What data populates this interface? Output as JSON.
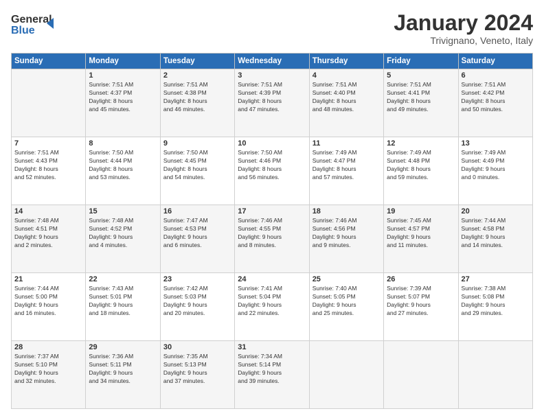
{
  "header": {
    "logo_line1": "General",
    "logo_line2": "Blue",
    "month_title": "January 2024",
    "location": "Trivignano, Veneto, Italy"
  },
  "weekdays": [
    "Sunday",
    "Monday",
    "Tuesday",
    "Wednesday",
    "Thursday",
    "Friday",
    "Saturday"
  ],
  "weeks": [
    [
      {
        "day": "",
        "content": ""
      },
      {
        "day": "1",
        "content": "Sunrise: 7:51 AM\nSunset: 4:37 PM\nDaylight: 8 hours\nand 45 minutes."
      },
      {
        "day": "2",
        "content": "Sunrise: 7:51 AM\nSunset: 4:38 PM\nDaylight: 8 hours\nand 46 minutes."
      },
      {
        "day": "3",
        "content": "Sunrise: 7:51 AM\nSunset: 4:39 PM\nDaylight: 8 hours\nand 47 minutes."
      },
      {
        "day": "4",
        "content": "Sunrise: 7:51 AM\nSunset: 4:40 PM\nDaylight: 8 hours\nand 48 minutes."
      },
      {
        "day": "5",
        "content": "Sunrise: 7:51 AM\nSunset: 4:41 PM\nDaylight: 8 hours\nand 49 minutes."
      },
      {
        "day": "6",
        "content": "Sunrise: 7:51 AM\nSunset: 4:42 PM\nDaylight: 8 hours\nand 50 minutes."
      }
    ],
    [
      {
        "day": "7",
        "content": "Sunrise: 7:51 AM\nSunset: 4:43 PM\nDaylight: 8 hours\nand 52 minutes."
      },
      {
        "day": "8",
        "content": "Sunrise: 7:50 AM\nSunset: 4:44 PM\nDaylight: 8 hours\nand 53 minutes."
      },
      {
        "day": "9",
        "content": "Sunrise: 7:50 AM\nSunset: 4:45 PM\nDaylight: 8 hours\nand 54 minutes."
      },
      {
        "day": "10",
        "content": "Sunrise: 7:50 AM\nSunset: 4:46 PM\nDaylight: 8 hours\nand 56 minutes."
      },
      {
        "day": "11",
        "content": "Sunrise: 7:49 AM\nSunset: 4:47 PM\nDaylight: 8 hours\nand 57 minutes."
      },
      {
        "day": "12",
        "content": "Sunrise: 7:49 AM\nSunset: 4:48 PM\nDaylight: 8 hours\nand 59 minutes."
      },
      {
        "day": "13",
        "content": "Sunrise: 7:49 AM\nSunset: 4:49 PM\nDaylight: 9 hours\nand 0 minutes."
      }
    ],
    [
      {
        "day": "14",
        "content": "Sunrise: 7:48 AM\nSunset: 4:51 PM\nDaylight: 9 hours\nand 2 minutes."
      },
      {
        "day": "15",
        "content": "Sunrise: 7:48 AM\nSunset: 4:52 PM\nDaylight: 9 hours\nand 4 minutes."
      },
      {
        "day": "16",
        "content": "Sunrise: 7:47 AM\nSunset: 4:53 PM\nDaylight: 9 hours\nand 6 minutes."
      },
      {
        "day": "17",
        "content": "Sunrise: 7:46 AM\nSunset: 4:55 PM\nDaylight: 9 hours\nand 8 minutes."
      },
      {
        "day": "18",
        "content": "Sunrise: 7:46 AM\nSunset: 4:56 PM\nDaylight: 9 hours\nand 9 minutes."
      },
      {
        "day": "19",
        "content": "Sunrise: 7:45 AM\nSunset: 4:57 PM\nDaylight: 9 hours\nand 11 minutes."
      },
      {
        "day": "20",
        "content": "Sunrise: 7:44 AM\nSunset: 4:58 PM\nDaylight: 9 hours\nand 14 minutes."
      }
    ],
    [
      {
        "day": "21",
        "content": "Sunrise: 7:44 AM\nSunset: 5:00 PM\nDaylight: 9 hours\nand 16 minutes."
      },
      {
        "day": "22",
        "content": "Sunrise: 7:43 AM\nSunset: 5:01 PM\nDaylight: 9 hours\nand 18 minutes."
      },
      {
        "day": "23",
        "content": "Sunrise: 7:42 AM\nSunset: 5:03 PM\nDaylight: 9 hours\nand 20 minutes."
      },
      {
        "day": "24",
        "content": "Sunrise: 7:41 AM\nSunset: 5:04 PM\nDaylight: 9 hours\nand 22 minutes."
      },
      {
        "day": "25",
        "content": "Sunrise: 7:40 AM\nSunset: 5:05 PM\nDaylight: 9 hours\nand 25 minutes."
      },
      {
        "day": "26",
        "content": "Sunrise: 7:39 AM\nSunset: 5:07 PM\nDaylight: 9 hours\nand 27 minutes."
      },
      {
        "day": "27",
        "content": "Sunrise: 7:38 AM\nSunset: 5:08 PM\nDaylight: 9 hours\nand 29 minutes."
      }
    ],
    [
      {
        "day": "28",
        "content": "Sunrise: 7:37 AM\nSunset: 5:10 PM\nDaylight: 9 hours\nand 32 minutes."
      },
      {
        "day": "29",
        "content": "Sunrise: 7:36 AM\nSunset: 5:11 PM\nDaylight: 9 hours\nand 34 minutes."
      },
      {
        "day": "30",
        "content": "Sunrise: 7:35 AM\nSunset: 5:13 PM\nDaylight: 9 hours\nand 37 minutes."
      },
      {
        "day": "31",
        "content": "Sunrise: 7:34 AM\nSunset: 5:14 PM\nDaylight: 9 hours\nand 39 minutes."
      },
      {
        "day": "",
        "content": ""
      },
      {
        "day": "",
        "content": ""
      },
      {
        "day": "",
        "content": ""
      }
    ]
  ]
}
